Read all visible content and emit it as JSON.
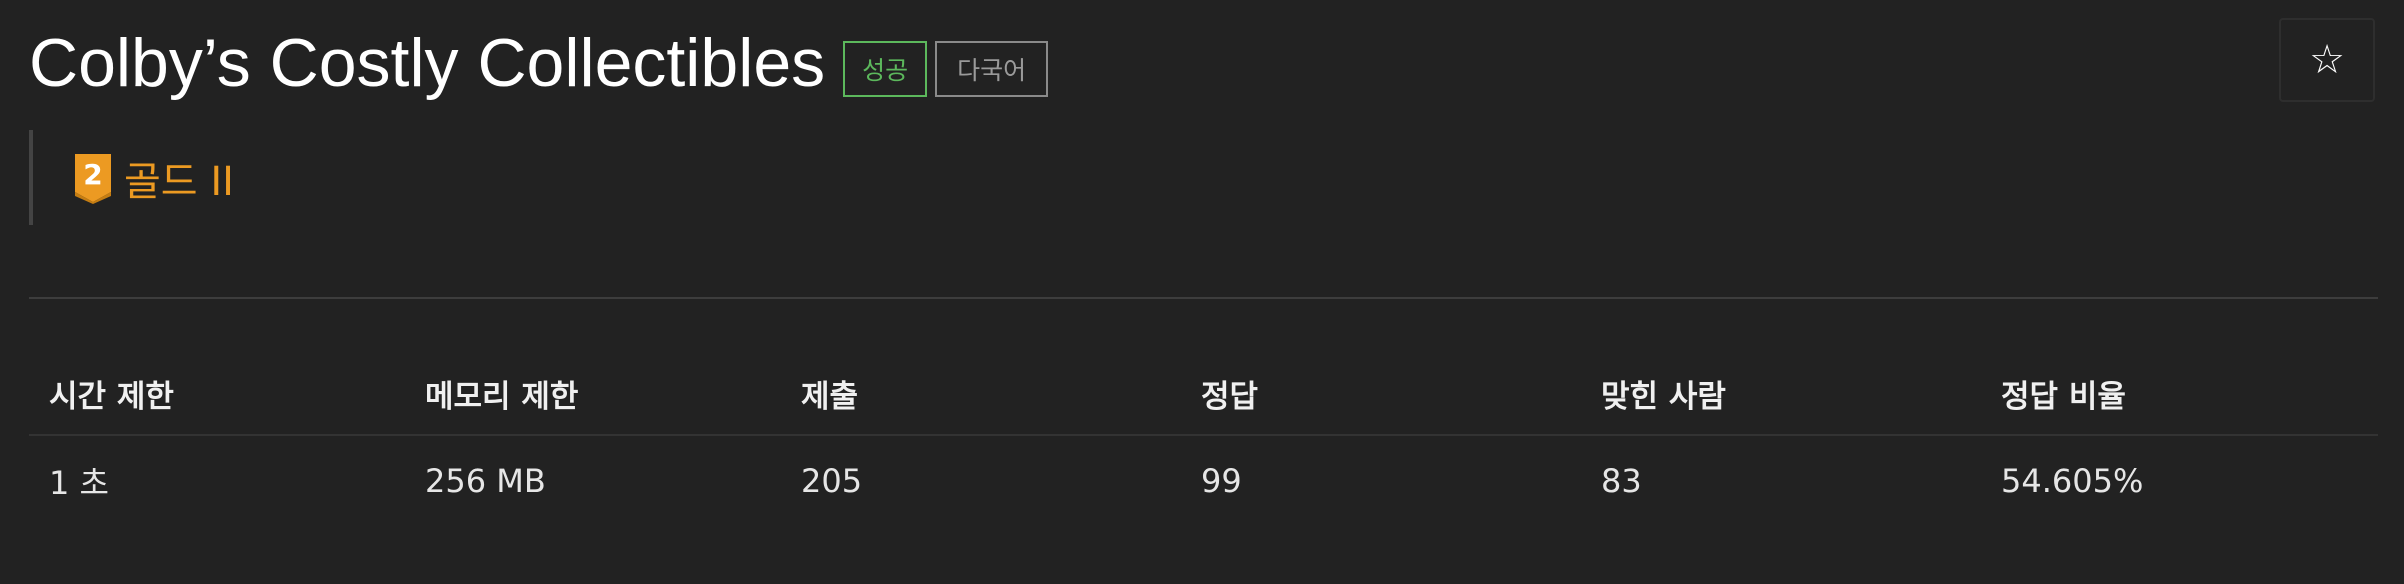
{
  "problem": {
    "title": "Colby’s Costly Collectibles",
    "badges": {
      "success": "성공",
      "multilang": "다국어"
    },
    "star_icon": "☆",
    "tier": {
      "level_number": "2",
      "label": "골드 II",
      "color": "#ec9a22"
    }
  },
  "stats": {
    "headers": [
      "시간 제한",
      "메모리 제한",
      "제출",
      "정답",
      "맞힌 사람",
      "정답 비율"
    ],
    "values": [
      "1 초",
      "256 MB",
      "205",
      "99",
      "83",
      "54.605%"
    ]
  },
  "colors": {
    "background": "#222222",
    "success": "#5cb85c",
    "gold": "#ec9a22"
  }
}
